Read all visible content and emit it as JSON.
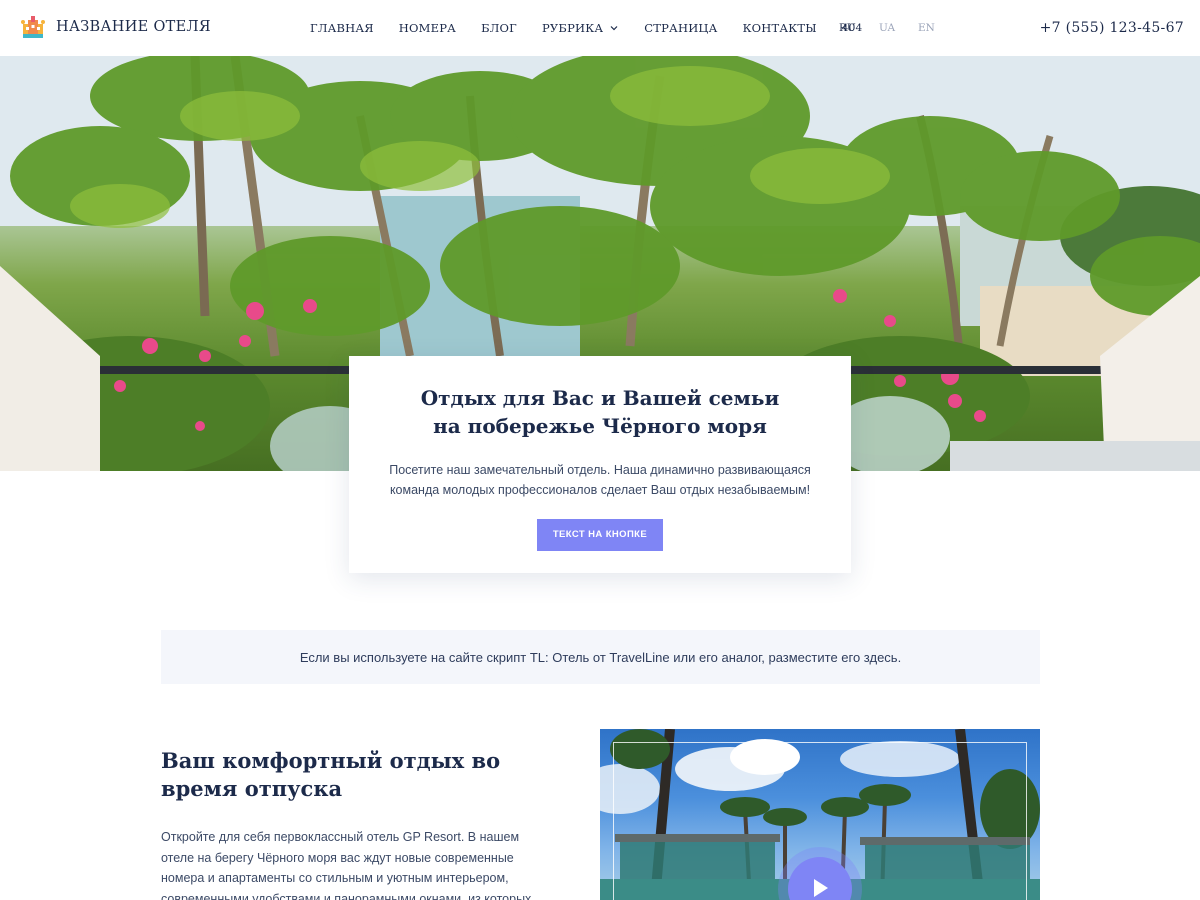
{
  "header": {
    "logo_text": "НАЗВАНИЕ ОТЕЛЯ",
    "nav": [
      {
        "label": "ГЛАВНАЯ"
      },
      {
        "label": "НОМЕРА"
      },
      {
        "label": "БЛОГ"
      },
      {
        "label": "РУБРИКА"
      },
      {
        "label": "СТРАНИЦА"
      },
      {
        "label": "КОНТАКТЫ"
      },
      {
        "label": "404"
      }
    ],
    "languages": [
      "RU",
      "UA",
      "EN"
    ],
    "active_language": "RU",
    "phone": "+7 (555) 123-45-67"
  },
  "hero_card": {
    "title": "Отдых для Вас и Вашей семьи на побережье Чёрного моря",
    "text": "Посетите наш замечательный отдель. Наша динамично развивающаяся команда молодых профессионалов сделает Ваш отдых незабываемым!",
    "button_label": "ТЕКСТ НА КНОПКЕ"
  },
  "infobar": {
    "text": "Если вы используете на сайте скрипт TL: Отель от TravelLine или его аналог, разместите его здесь."
  },
  "comfort": {
    "title": "Ваш комфортный отдых во время отпуска",
    "text": "Откройте для себя первоклассный отель GP Resort. В нашем отеле на берегу Чёрного моря вас ждут новые современные номера и апартаменты со стильным и уютным интерьером, современными удобствами и панорамными окнами, из которых"
  },
  "colors": {
    "accent": "#7f85f5",
    "text_dark": "#1c2a4a",
    "infobar_bg": "#f4f6fb"
  },
  "icons": {
    "logo": "hotel-logo-icon",
    "rubric_dropdown": "chevron-down-icon",
    "video_play": "play-icon"
  }
}
